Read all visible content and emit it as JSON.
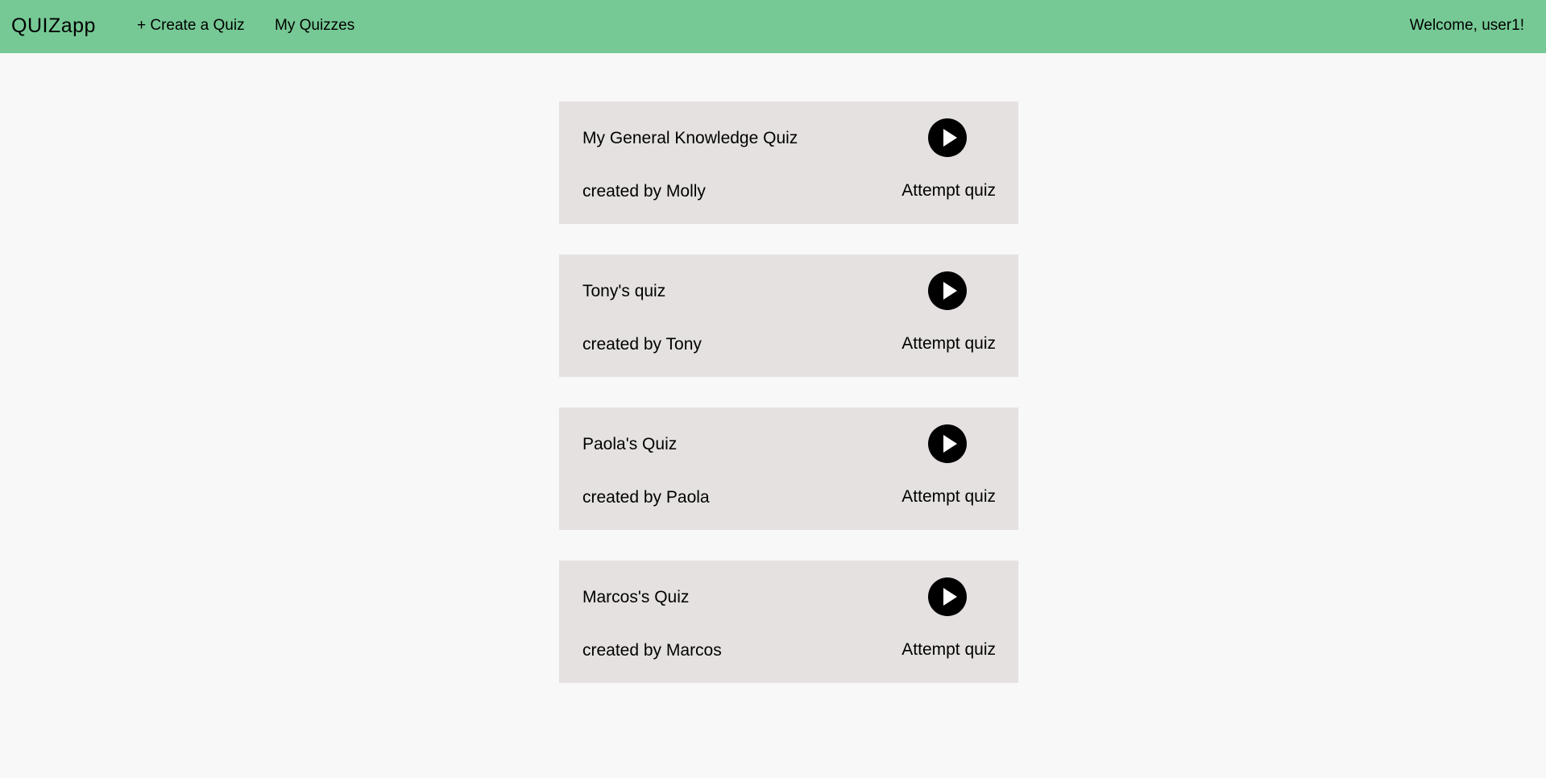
{
  "header": {
    "brand_bold": "QUIZ",
    "brand_light": "app",
    "create_label": "+ Create a Quiz",
    "my_quizzes_label": "My Quizzes",
    "welcome_text": "Welcome, user1!"
  },
  "quizzes": [
    {
      "title": "My General Knowledge Quiz",
      "author": "created by Molly",
      "action_label": "Attempt quiz"
    },
    {
      "title": "Tony's quiz",
      "author": "created by Tony",
      "action_label": "Attempt quiz"
    },
    {
      "title": "Paola's Quiz",
      "author": "created by Paola",
      "action_label": "Attempt quiz"
    },
    {
      "title": "Marcos's Quiz",
      "author": "created by Marcos",
      "action_label": "Attempt quiz"
    }
  ],
  "icons": {
    "play": "play-icon"
  },
  "colors": {
    "header_bg": "#76c995",
    "card_bg": "#e5e1e0",
    "page_bg": "#f8f8f8"
  }
}
